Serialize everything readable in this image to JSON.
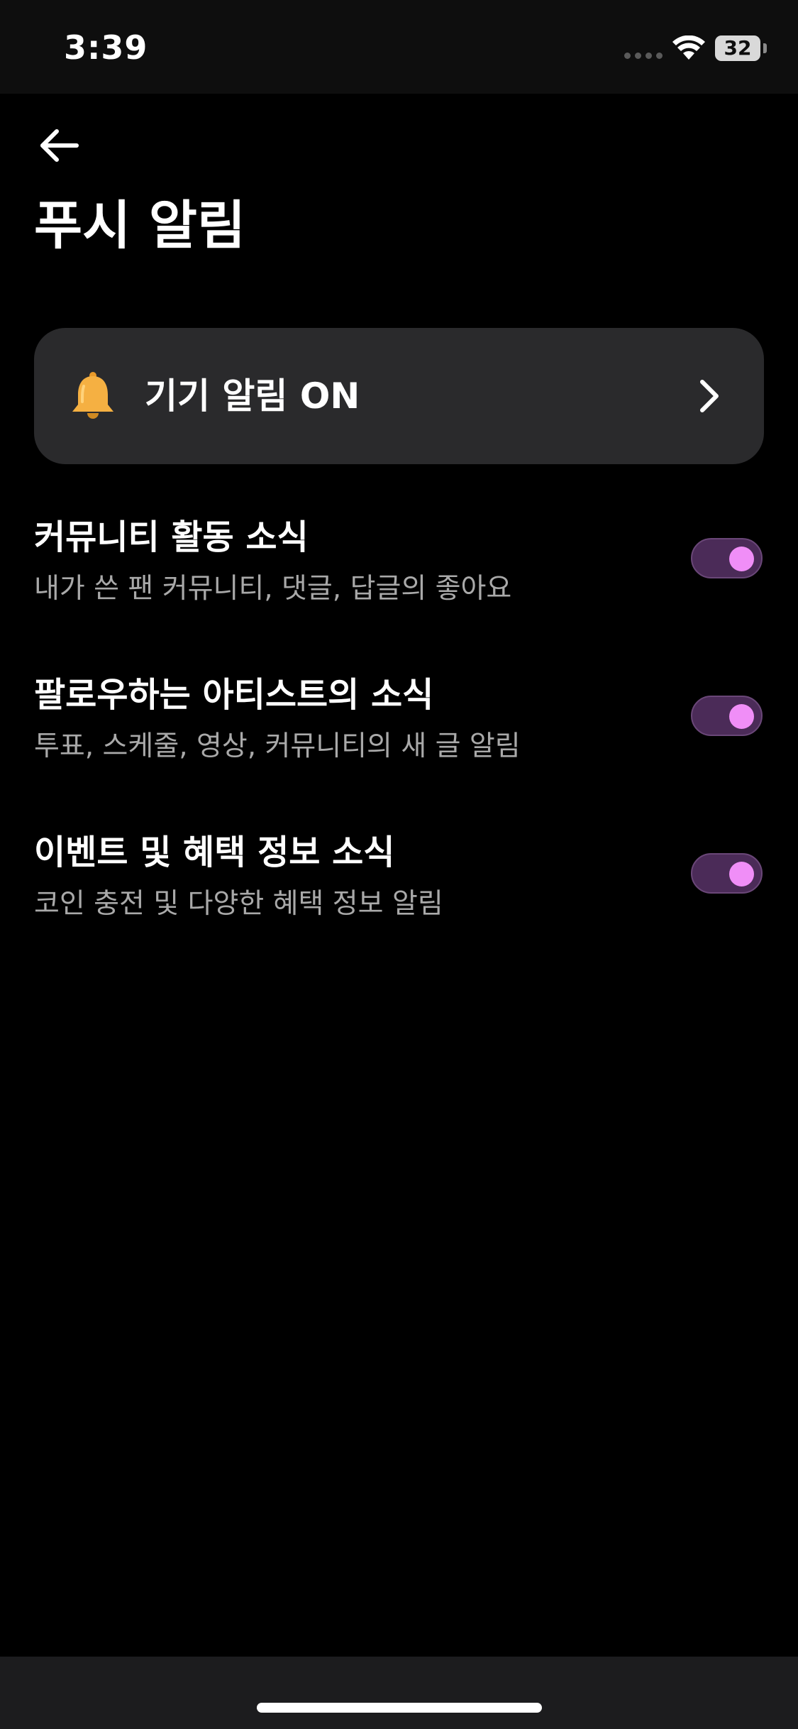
{
  "status_bar": {
    "time": "3:39",
    "battery": "32",
    "icons": [
      "signal-dots-icon",
      "wifi-icon",
      "battery-icon"
    ]
  },
  "header": {
    "back_icon": "arrow-left-icon",
    "title": "푸시 알림"
  },
  "device_alert": {
    "icon": "bell-icon",
    "label": "기기 알림 ON",
    "chevron_icon": "chevron-right-icon"
  },
  "settings": [
    {
      "title": "커뮤니티 활동 소식",
      "description": "내가 쓴 팬 커뮤니티, 댓글, 답글의 좋아요",
      "enabled": true
    },
    {
      "title": "팔로우하는 아티스트의 소식",
      "description": "투표, 스케줄, 영상, 커뮤니티의 새 글 알림",
      "enabled": true
    },
    {
      "title": "이벤트 및 혜택 정보 소식",
      "description": "코인 충전 및 다양한 혜택 정보 알림",
      "enabled": true
    }
  ],
  "colors": {
    "background": "#000000",
    "card": "#2a2a2c",
    "toggle_track": "#4b2b58",
    "toggle_knob": "#f08ef7",
    "secondary_text": "#a9a9a9"
  }
}
